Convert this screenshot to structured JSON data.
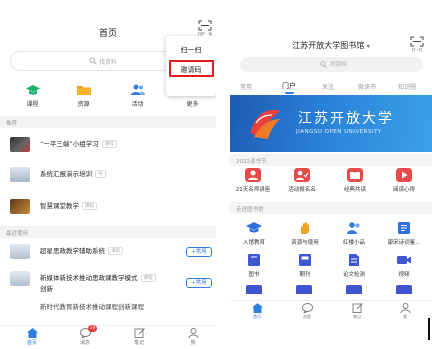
{
  "left": {
    "header": {
      "title": "首页",
      "scan_caption": "扫码入库"
    },
    "search": {
      "placeholder": "找资料"
    },
    "dropdown": {
      "items": [
        "扫一扫",
        "邀请码"
      ]
    },
    "nav": [
      {
        "label": "课程",
        "icon": "graduation-cap-icon",
        "color": "#17b26a"
      },
      {
        "label": "资源",
        "icon": "folder-icon",
        "color": "#f0a020"
      },
      {
        "label": "活动",
        "icon": "people-icon",
        "color": "#2f7fe0"
      },
      {
        "label": "更多",
        "icon": "grid-icon",
        "color": "#e03b3b"
      }
    ],
    "section_recommend": "推荐",
    "recommend": [
      {
        "title": "“一平三端”小组学习",
        "tag": "课程"
      },
      {
        "title": "系统汇报演示培训",
        "tag": "书"
      },
      {
        "title": "智慧课堂教学",
        "tag": "课程"
      }
    ],
    "section_recent": "最近使用",
    "recent": [
      {
        "title": "超星思政教学辅助系统",
        "tag": "课程",
        "button": "+常用"
      },
      {
        "title": "新媒体新技术推动思政课教学模式",
        "title2": "创新",
        "tag": "课程",
        "button": "+常用"
      },
      {
        "title": "新时代教育新技术推动课程创新课程"
      }
    ],
    "tabbar": [
      {
        "label": "首页",
        "icon": "home-icon",
        "active": true
      },
      {
        "label": "消息",
        "icon": "chat-icon",
        "badge": "19"
      },
      {
        "label": "笔记",
        "icon": "note-icon"
      },
      {
        "label": "我",
        "icon": "person-icon"
      }
    ]
  },
  "right": {
    "header": {
      "title": "江苏开放大学图书馆",
      "scan_caption": "扫一扫"
    },
    "search": {
      "placeholder": "找资料"
    },
    "tabs": [
      "常用",
      "门户",
      "关注",
      "微读书",
      "知识圈"
    ],
    "active_tab": "门户",
    "banner": {
      "title": "江苏开放大学",
      "subtitle": "JIANGSU OPEN UNIVERSITY"
    },
    "section_festival": "2022读书节",
    "festival": [
      {
        "label": "21天名师讲座",
        "icon": "lecture-icon",
        "color": "#e84a4a"
      },
      {
        "label": "活动报名名",
        "icon": "signup-icon",
        "color": "#e84a4a"
      },
      {
        "label": "经典共读",
        "icon": "book-icon",
        "color": "#e84a4a"
      },
      {
        "label": "阅读心得",
        "icon": "play-icon",
        "color": "#e84a4a"
      }
    ],
    "section_library": "走进图书馆",
    "library_row1": [
      {
        "label": "入馆教育",
        "icon": "graduation-cap-icon",
        "color": "#2f6fe0"
      },
      {
        "label": "资源与使用",
        "icon": "hand-icon",
        "color": "#f0a020"
      },
      {
        "label": "红楼小品",
        "icon": "people-icon",
        "color": "#2f7fe0"
      },
      {
        "label": "康宋诗词鉴...",
        "icon": "poem-icon",
        "color": "#2f6fe0"
      }
    ],
    "library_row2": [
      {
        "label": "图书",
        "icon": "book-icon",
        "color": "#3f56d0"
      },
      {
        "label": "期刊",
        "icon": "journal-icon",
        "color": "#3f56d0"
      },
      {
        "label": "论文检测",
        "icon": "document-icon",
        "color": "#3f56d0"
      },
      {
        "label": "视频",
        "icon": "video-icon",
        "color": "#3f56d0"
      }
    ],
    "tabbar": [
      {
        "label": "首页",
        "icon": "home-icon",
        "active": true
      },
      {
        "label": "消息",
        "icon": "chat-icon"
      },
      {
        "label": "笔记",
        "icon": "note-icon"
      },
      {
        "label": "我",
        "icon": "person-icon"
      }
    ]
  },
  "colors": {
    "accent_blue": "#2f7fe0",
    "highlight_red": "#e02020"
  }
}
